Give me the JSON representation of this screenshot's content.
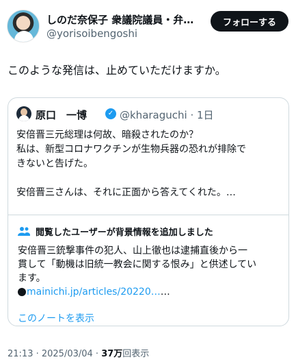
{
  "author": {
    "name": "しのだ奈保子 衆議院議員・弁…",
    "handle": "@yorisoibengoshi",
    "follow_label": "フォローする"
  },
  "post": {
    "text": "このような発信は、止めていただけますか。"
  },
  "quoted": {
    "name": "原口　一博",
    "handle": "@kharaguchi · 1日",
    "lines": [
      "安倍晋三元総理は何故、暗殺されたのか？",
      "私は、新型コロナワクチンが生物兵器の恐れが排除で",
      "きないと告げた。",
      "安倍晋三さんは、それに正面から答えてくれた。…"
    ]
  },
  "community_note": {
    "title": "閲覧したユーザーが背景情報を追加しました",
    "lines": [
      "安倍晋三銃撃事件の犯人、山上徹也は逮捕直後から一",
      "貫して「動機は旧統一教会に関する恨み」と供述してい",
      "ます。"
    ],
    "link_text": "mainichi.jp/articles/20220…",
    "link_suffix": "…",
    "show_label": "このノートを表示"
  },
  "meta": {
    "time": "21:13 · 2025/03/04 · ",
    "views": "37万",
    "views_label": "回表示"
  },
  "colors": {
    "accent": "#1d9bf0",
    "text": "#0f1419",
    "muted": "#536471",
    "border": "#cfd9de"
  }
}
